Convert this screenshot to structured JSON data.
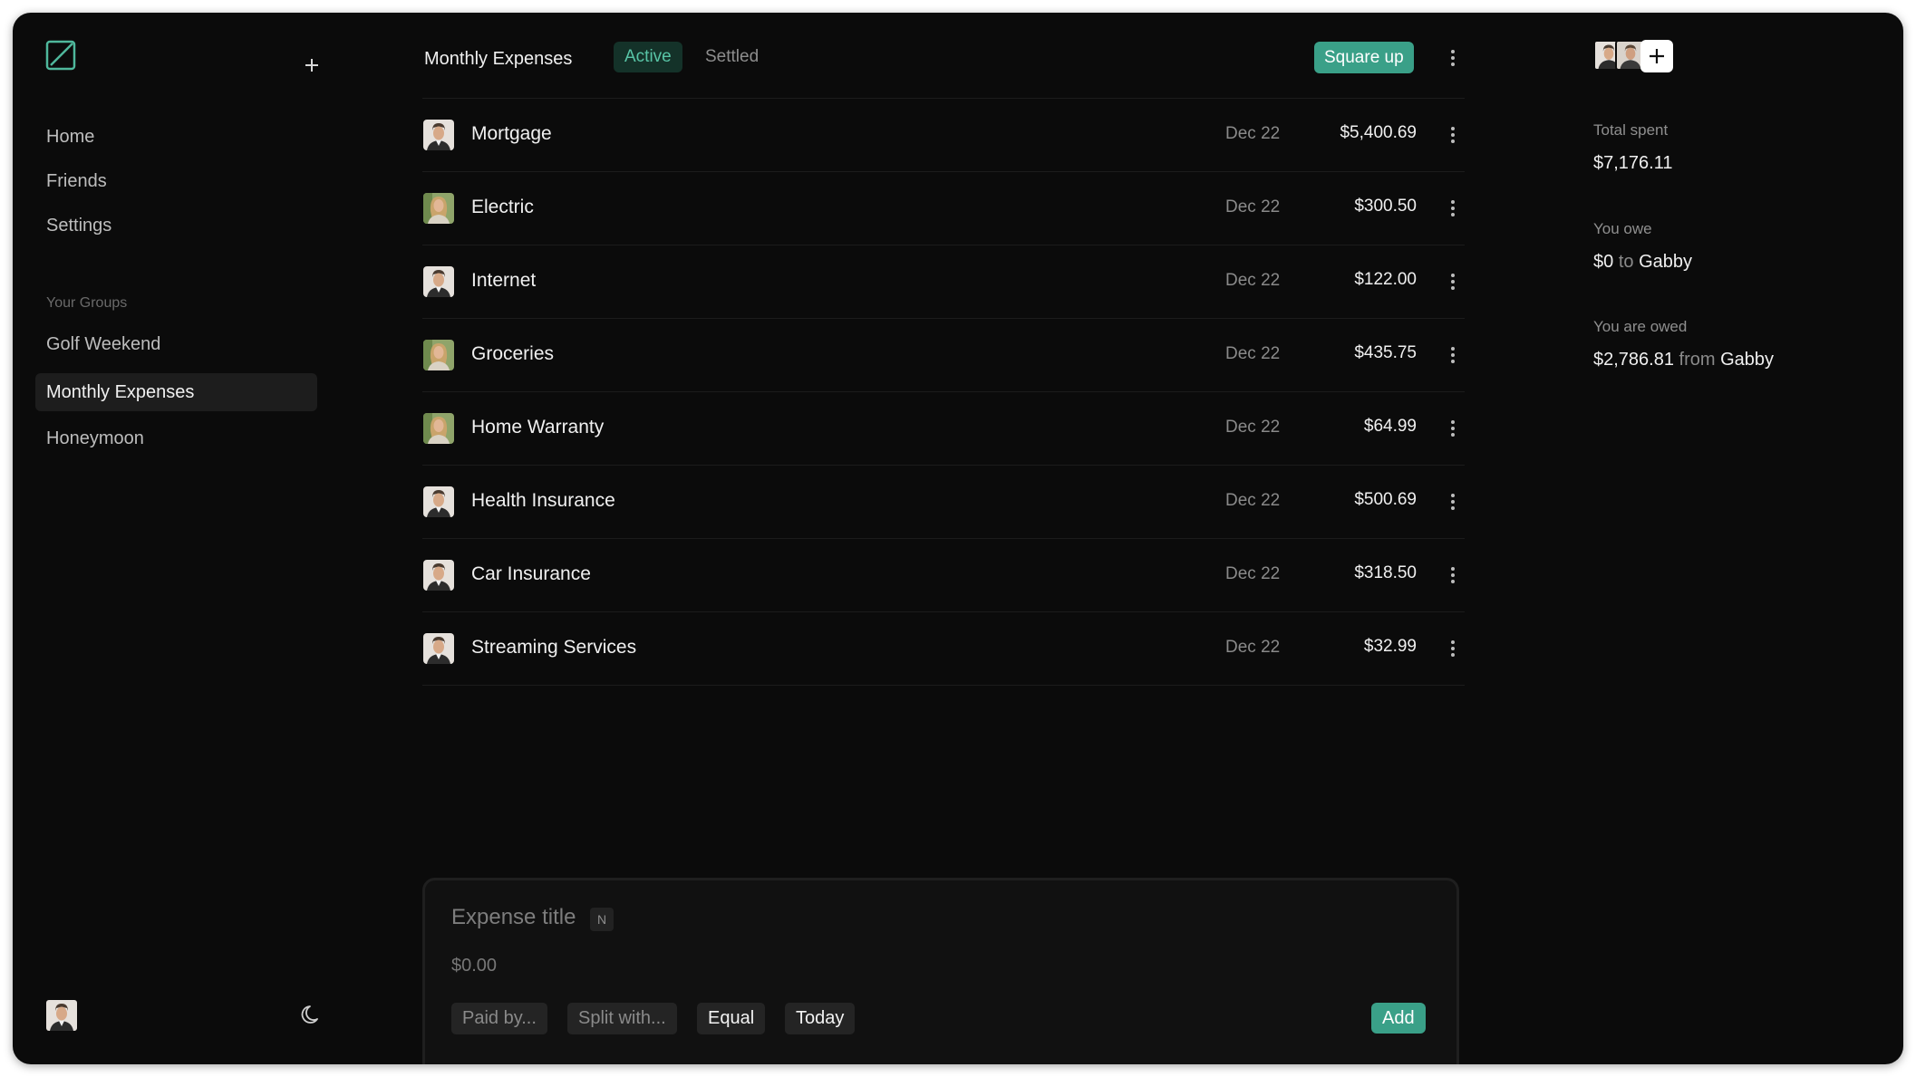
{
  "sidebar": {
    "nav": [
      {
        "label": "Home"
      },
      {
        "label": "Friends"
      },
      {
        "label": "Settings"
      }
    ],
    "groups_heading": "Your Groups",
    "groups": [
      {
        "label": "Golf Weekend"
      },
      {
        "label": "Monthly Expenses"
      },
      {
        "label": "Honeymoon"
      }
    ],
    "active_group": "Monthly Expenses"
  },
  "header": {
    "title": "Monthly Expenses",
    "tab_active": "Active",
    "tab_settled": "Settled",
    "square_up": "Square up"
  },
  "expenses": [
    {
      "title": "Mortgage",
      "date": "Dec 22",
      "amount": "$5,400.69",
      "payer": "man"
    },
    {
      "title": "Electric",
      "date": "Dec 22",
      "amount": "$300.50",
      "payer": "woman"
    },
    {
      "title": "Internet",
      "date": "Dec 22",
      "amount": "$122.00",
      "payer": "man"
    },
    {
      "title": "Groceries",
      "date": "Dec 22",
      "amount": "$435.75",
      "payer": "woman"
    },
    {
      "title": "Home Warranty",
      "date": "Dec 22",
      "amount": "$64.99",
      "payer": "woman"
    },
    {
      "title": "Health Insurance",
      "date": "Dec 22",
      "amount": "$500.69",
      "payer": "man"
    },
    {
      "title": "Car Insurance",
      "date": "Dec 22",
      "amount": "$318.50",
      "payer": "man"
    },
    {
      "title": "Streaming Services",
      "date": "Dec 22",
      "amount": "$32.99",
      "payer": "man"
    }
  ],
  "composer": {
    "title_placeholder": "Expense title",
    "shortcut": "N",
    "amount_placeholder": "$0.00",
    "paid_by": "Paid by...",
    "split_with": "Split with...",
    "split_mode": "Equal",
    "date": "Today",
    "add": "Add"
  },
  "summary": {
    "total_spent_label": "Total spent",
    "total_spent": "$7,176.11",
    "you_owe_label": "You owe",
    "you_owe_amount": "$0",
    "you_owe_connector": "to",
    "you_owe_person": "Gabby",
    "owed_label": "You are owed",
    "owed_amount": "$2,786.81",
    "owed_connector": "from",
    "owed_person": "Gabby"
  },
  "colors": {
    "accent": "#3aa088",
    "accent_text": "#58c4a6",
    "background": "#0b0b0b"
  },
  "icons": {
    "logo": "split-square-icon",
    "new": "plus-icon",
    "theme": "moon-icon",
    "more": "kebab-icon",
    "add_member": "plus-icon"
  }
}
